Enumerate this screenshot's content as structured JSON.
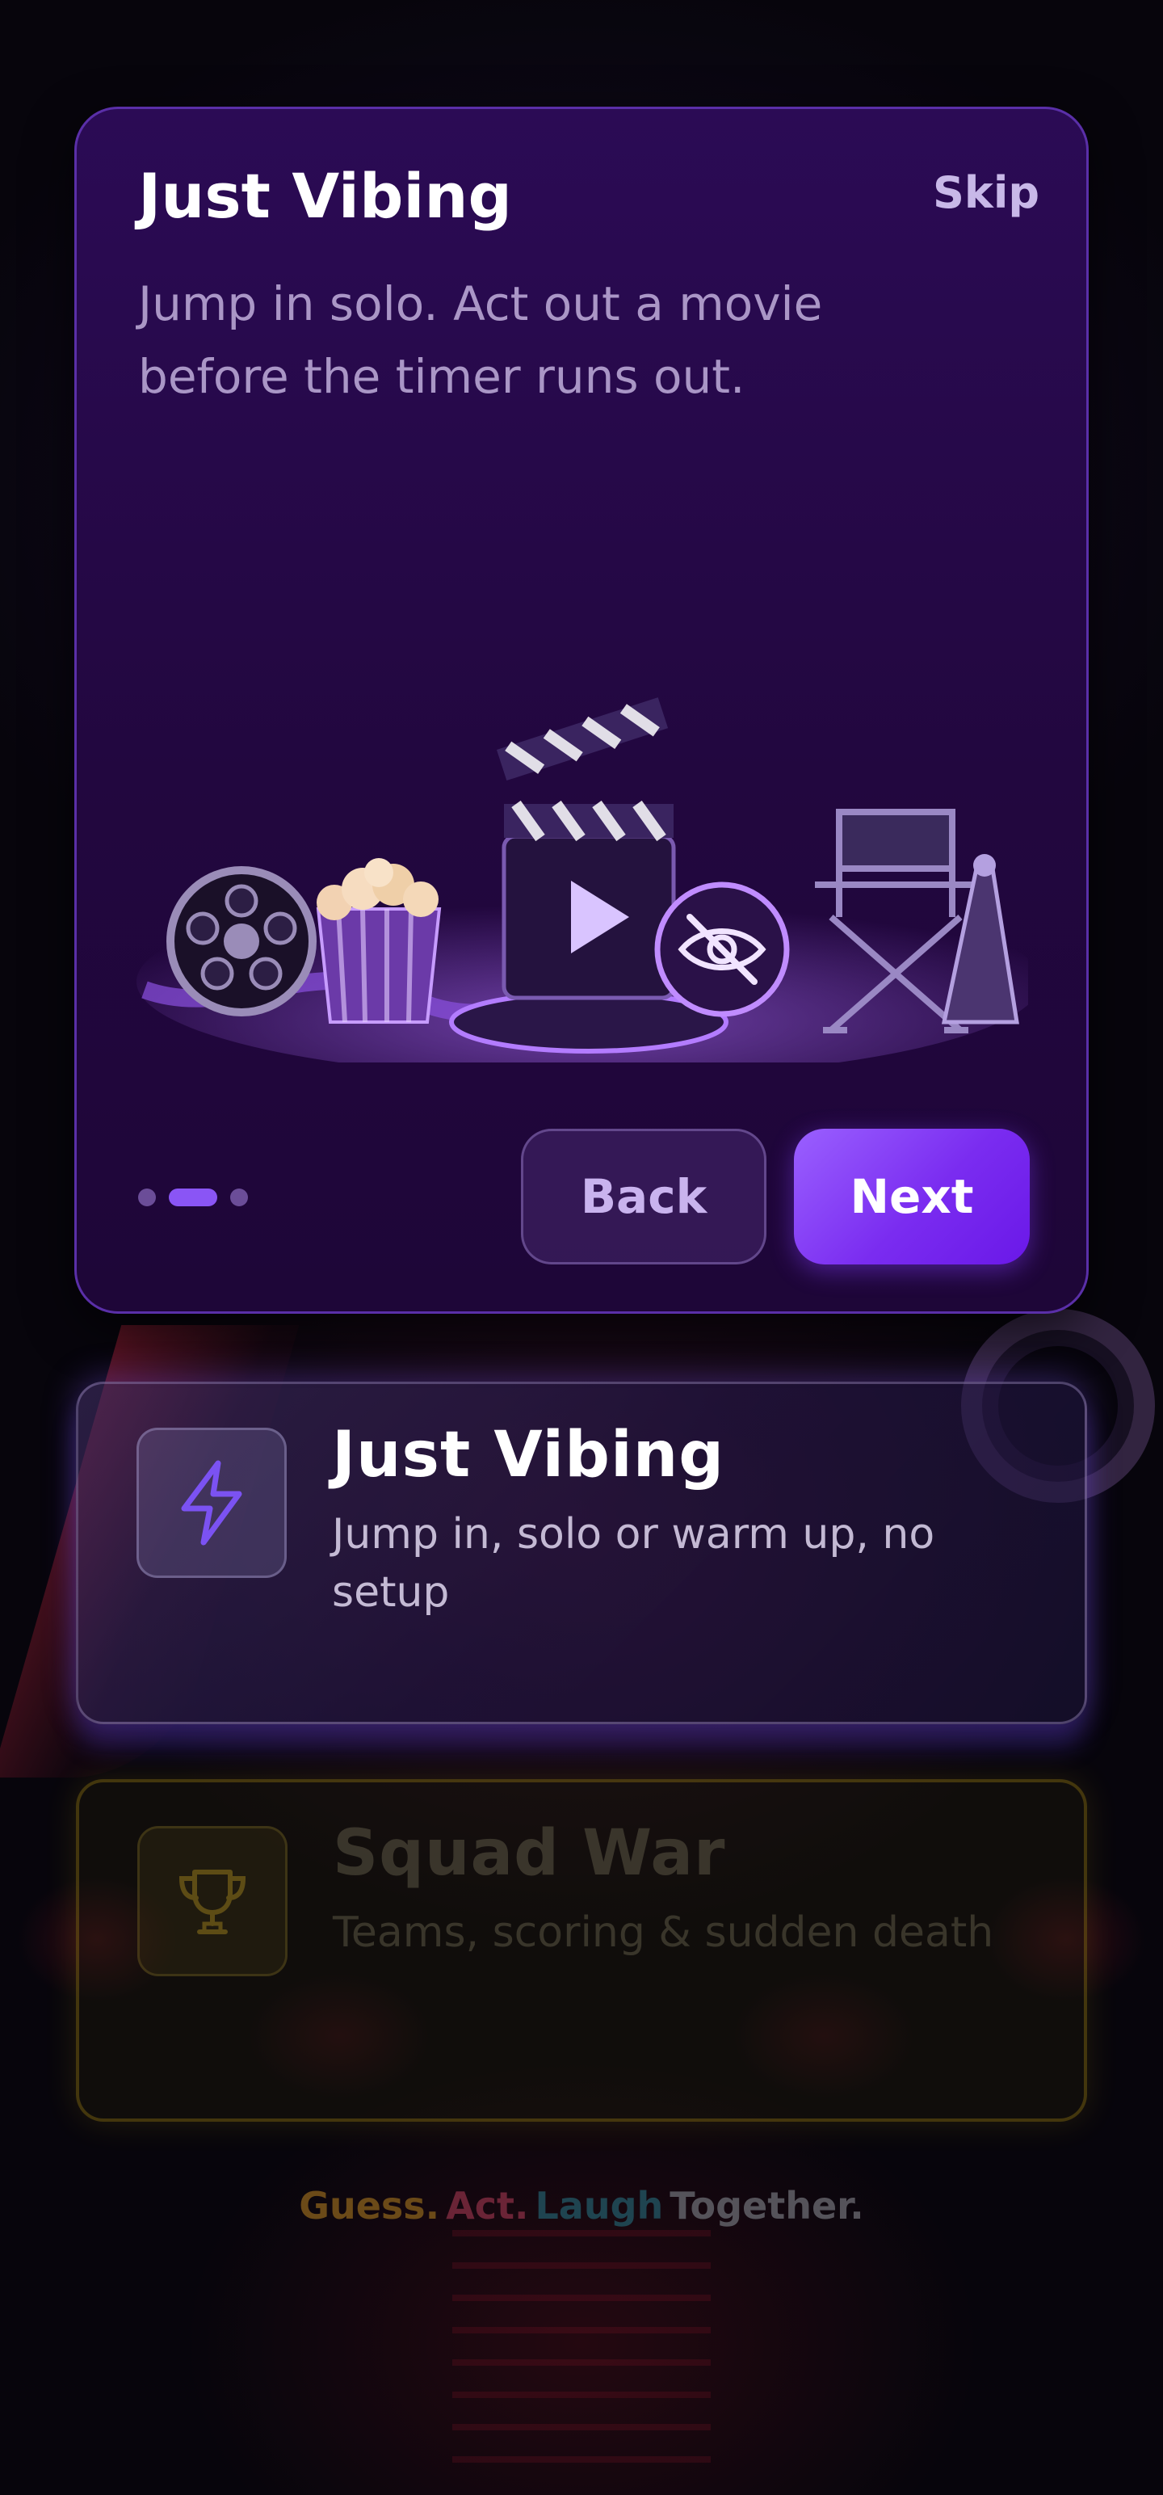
{
  "modal": {
    "title": "Just Vibing",
    "skip_label": "Skip",
    "description": "Jump in solo. Act out a movie before the timer runs out.",
    "step_current": 2,
    "step_total": 3,
    "back_label": "Back",
    "next_label": "Next"
  },
  "modes": [
    {
      "title": "Just Vibing",
      "description": "Jump in, solo or warm up, no setup",
      "icon": "lightning-icon",
      "accent": "#7b52f2",
      "state": "selected"
    },
    {
      "title": "Squad War",
      "description": "Teams, scoring & sudden death",
      "icon": "trophy-icon",
      "accent": "#9a7a10",
      "state": "dimmed"
    }
  ],
  "tagline": {
    "word1": "Guess.",
    "word2": "Act.",
    "word3": "Laugh",
    "word4": "Together."
  },
  "colors": {
    "modal_bg": "#2b0b55",
    "primary": "#7a2cf0",
    "background": "#07050c"
  }
}
